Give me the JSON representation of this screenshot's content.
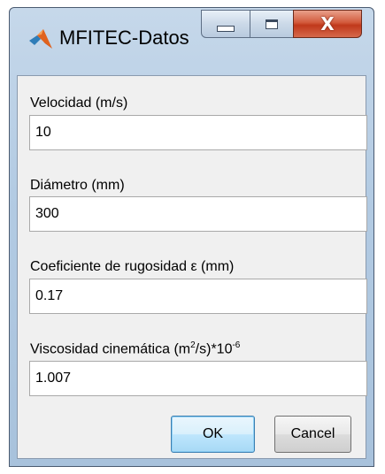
{
  "window": {
    "title": "MFITEC-Datos",
    "close_glyph": "X"
  },
  "fields": [
    {
      "label": "Velocidad (m/s)",
      "value": "10"
    },
    {
      "label": "Diámetro (mm)",
      "value": "300"
    },
    {
      "label": "Coeficiente de rugosidad ε (mm)",
      "value": "0.17"
    },
    {
      "label_parts": {
        "a": "Viscosidad cinemática (m",
        "sup1": "2",
        "b": "/s)*10",
        "sup2": "-6"
      },
      "value": "1.007"
    }
  ],
  "buttons": {
    "ok_label": "OK",
    "cancel_label": "Cancel"
  },
  "icons": {
    "app": "matlab-icon",
    "minimize": "minimize-icon",
    "maximize": "maximize-icon",
    "close": "close-icon"
  },
  "colors": {
    "titlebar": "#b3cbe3",
    "close_button": "#c0381b",
    "ok_button_border": "#3c7fb1",
    "client_background": "#f0f0f0"
  }
}
